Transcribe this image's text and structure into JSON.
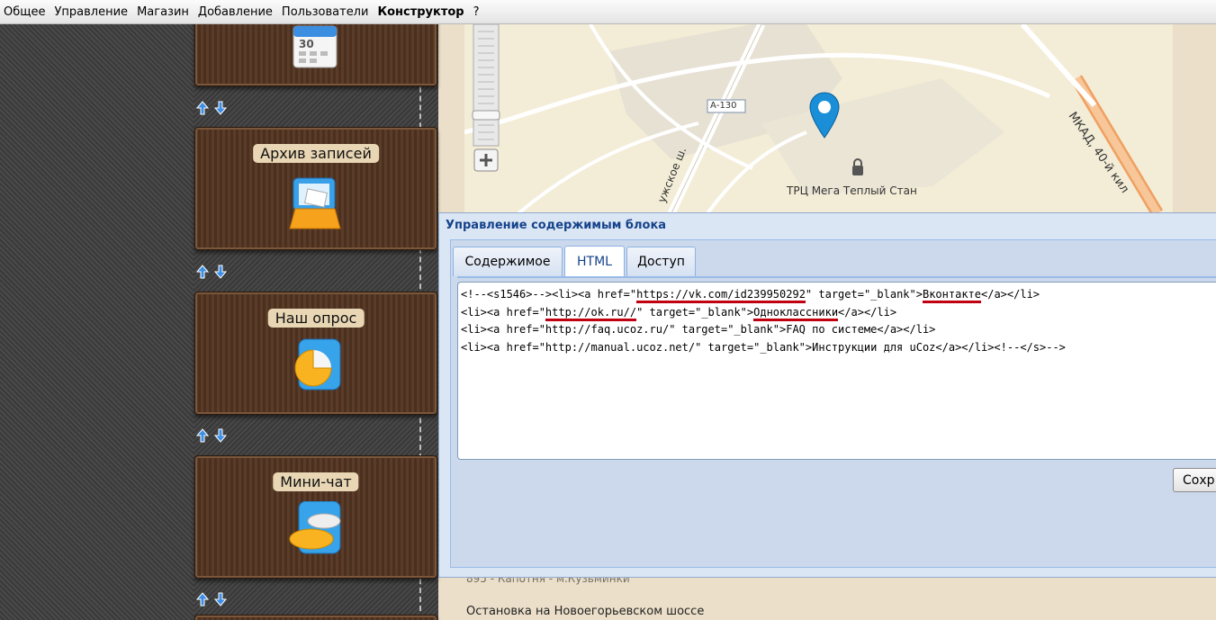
{
  "menu": {
    "items": [
      "Общее",
      "Управление",
      "Магазин",
      "Добавление",
      "Пользователи",
      "Конструктор",
      "?"
    ]
  },
  "modules": {
    "archive_title": "Архив записей",
    "poll_title": "Наш опрос",
    "chat_title": "Мини-чат",
    "calendar_icon_text": "30"
  },
  "map": {
    "road_a130": "А-130",
    "road_mkad": "МКАД, 40-й кил",
    "road_kaluzh": "ужское ш.",
    "poi_label": "ТРЦ Мега Теплый Стан"
  },
  "dialog": {
    "title": "Управление содержимым блока",
    "tabs": [
      "Содержимое",
      "HTML",
      "Доступ"
    ],
    "active_tab": "HTML",
    "code": {
      "line1": {
        "pre": "<!--<s1546>--><li><a href=\"",
        "url": "https://vk.com/id239950292",
        "mid": "\" target=\"_blank\">",
        "text": "Вконтакте",
        "post": "</a></li>"
      },
      "line2": {
        "pre": "<li><a href=\"",
        "url": "http://ok.ru//",
        "mid": "\" target=\"_blank\">",
        "text": "Одноклассники",
        "post": "</a></li>"
      },
      "line3": "<li><a href=\"http://faq.ucoz.ru/\" target=\"_blank\">FAQ по системе</a></li>",
      "line4": "<li><a href=\"http://manual.ucoz.net/\" target=\"_blank\">Инструкции для uCoz</a></li><!--</s>-->"
    },
    "save_button": "Сохр"
  },
  "page_below": {
    "line1": "Остановка на Новоегорьевском шоссе",
    "line_partial": "895 - Капотня - м.Кузьминки"
  },
  "colors": {
    "dialog_title": "#15428b",
    "underline": "#c00010",
    "map_pin": "#1a8fd8"
  }
}
